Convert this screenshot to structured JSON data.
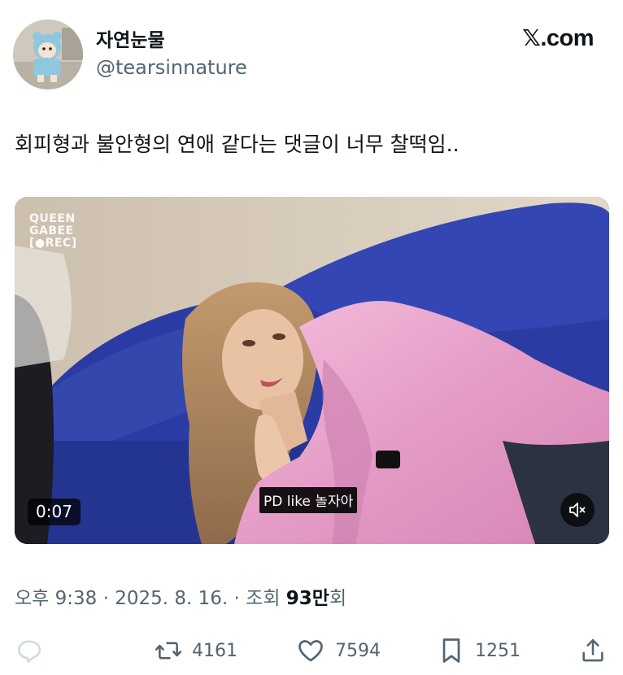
{
  "author": {
    "display_name": "자연눈물",
    "handle": "@tearsinnature"
  },
  "brand": {
    "x_glyph": "𝕏",
    "suffix": ".com"
  },
  "tweet": {
    "text": "회피형과 불안형의 연애 같다는 댓글이 너무 찰떡임.."
  },
  "media": {
    "watermark_lines": [
      "QUEEN",
      "GABEE",
      "[●REC]"
    ],
    "subtitle": "PD like 놀자아",
    "timestamp": "0:07",
    "muted": true,
    "icons": {
      "mute": "speaker-muted-icon"
    }
  },
  "meta": {
    "time": "오후 9:38",
    "separator": " · ",
    "date": "2025. 8. 16.",
    "views_label": "조회 ",
    "views_count": "93만",
    "views_suffix": "회"
  },
  "actions": {
    "reply": {
      "icon": "reply-icon",
      "count": ""
    },
    "retweet": {
      "icon": "retweet-icon",
      "count": "4161"
    },
    "like": {
      "icon": "heart-icon",
      "count": "7594"
    },
    "bookmark": {
      "icon": "bookmark-icon",
      "count": "1251"
    },
    "share": {
      "icon": "share-icon",
      "count": ""
    }
  },
  "colors": {
    "text_primary": "#0f1419",
    "text_secondary": "#536471",
    "reply_icon": "#cfd9de",
    "sofa_blue": "#2a3a8c",
    "outfit_pink": "#e7a3c9"
  }
}
